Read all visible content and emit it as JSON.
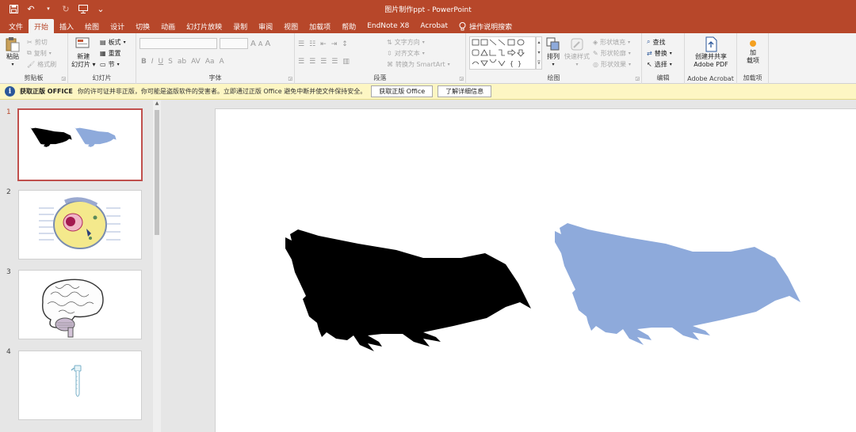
{
  "window": {
    "title": "图片制作ppt  -  PowerPoint"
  },
  "qat": {
    "save": "save-icon",
    "undo": "undo-icon",
    "redo": "redo-icon",
    "start": "from-beginning-icon",
    "more": "⌄"
  },
  "tabs": [
    "文件",
    "开始",
    "插入",
    "绘图",
    "设计",
    "切换",
    "动画",
    "幻灯片放映",
    "录制",
    "审阅",
    "视图",
    "加载项",
    "帮助",
    "EndNote X8",
    "Acrobat"
  ],
  "active_tab": "开始",
  "search_tab": {
    "label": "操作说明搜索",
    "icon": "lightbulb-icon"
  },
  "ribbon": {
    "clipboard": {
      "paste": "粘贴",
      "cut": "剪切",
      "copy": "复制",
      "format_painter": "格式刷",
      "label": "剪贴板"
    },
    "slides": {
      "new_slide_line1": "新建",
      "new_slide_line2": "幻灯片",
      "layout": "板式",
      "reset": "重置",
      "section": "节",
      "label": "幻灯片"
    },
    "font": {
      "label": "字体",
      "font_name": "",
      "font_size": "",
      "bold": "B",
      "italic": "I",
      "underline": "U",
      "strike": "S",
      "shadow": "ab",
      "spacing": "AV",
      "case": "Aa",
      "color": "A",
      "grow": "A",
      "shrink": "A",
      "clear": "A"
    },
    "paragraph": {
      "label": "段落",
      "text_direction": "文字方向",
      "align_text": "对齐文本",
      "smartart": "转换为 SmartArt"
    },
    "drawing": {
      "label": "绘图",
      "arrange": "排列",
      "quick_styles": "快速样式",
      "shape_fill": "形状填充",
      "shape_outline": "形状轮廓",
      "shape_effects": "形状效果"
    },
    "editing": {
      "label": "编辑",
      "find": "查找",
      "replace": "替换",
      "select": "选择"
    },
    "acrobat": {
      "label": "Adobe Acrobat",
      "create_line1": "创建并共享",
      "create_line2": "Adobe PDF"
    },
    "addins": {
      "label": "加载项",
      "btn_line1": "加",
      "btn_line2": "载项"
    }
  },
  "message_bar": {
    "title": "获取正版 OFFICE",
    "text": "你的许可证并非正版，你可能是盗版软件的受害者。立即通过正版 Office 避免中断并使文件保持安全。",
    "button1": "获取正版 Office",
    "button2": "了解详细信息"
  },
  "slides": [
    {
      "number": "1",
      "content": "bird-silhouettes"
    },
    {
      "number": "2",
      "content": "cell-diagram"
    },
    {
      "number": "3",
      "content": "brain-drawing"
    },
    {
      "number": "4",
      "content": "test-tube"
    }
  ],
  "active_slide": "1",
  "colors": {
    "accent": "#b7472a",
    "bird_dark": "#000000",
    "bird_light": "#8eaadb",
    "message_bar": "#fdf6c3"
  }
}
